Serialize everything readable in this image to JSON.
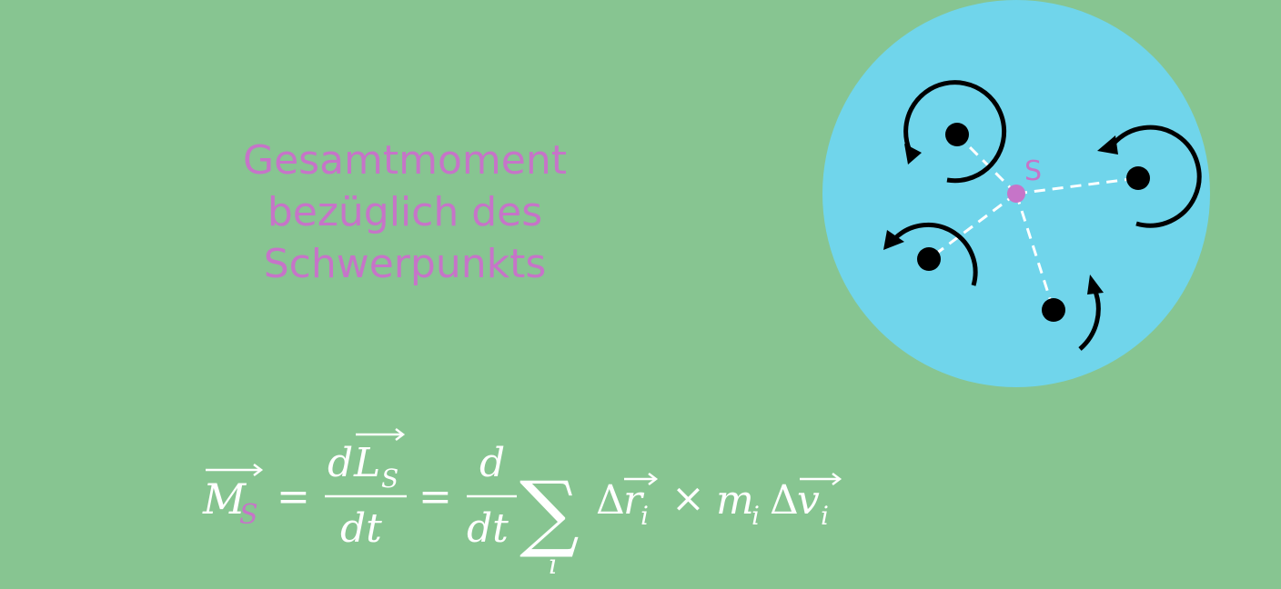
{
  "heading": {
    "line1": "Gesamtmoment",
    "line2": "bezüglich des",
    "line3": "Schwerpunkts"
  },
  "diagram": {
    "center_label": "S",
    "colors": {
      "background": "#87c591",
      "body": "#70d5eb",
      "center": "#c674c8",
      "particle": "#000000",
      "link": "#ffffff"
    }
  },
  "formula": {
    "lhs_symbol": "M",
    "lhs_subscript": "S",
    "equals": "=",
    "num1_d": "d",
    "num1_symbol": "L",
    "num1_subscript": "S",
    "den1": "dt",
    "num2": "d",
    "den2": "dt",
    "sum_symbol": "∑",
    "sum_index": "i",
    "delta1": "Δ",
    "r_symbol": "r",
    "r_subscript": "i",
    "times": "×",
    "m_symbol": "m",
    "m_subscript": "i",
    "delta2": "Δ",
    "v_symbol": "v",
    "v_subscript": "i",
    "colors": {
      "text": "#ffffff",
      "subscript_accent": "#c674c8"
    }
  }
}
